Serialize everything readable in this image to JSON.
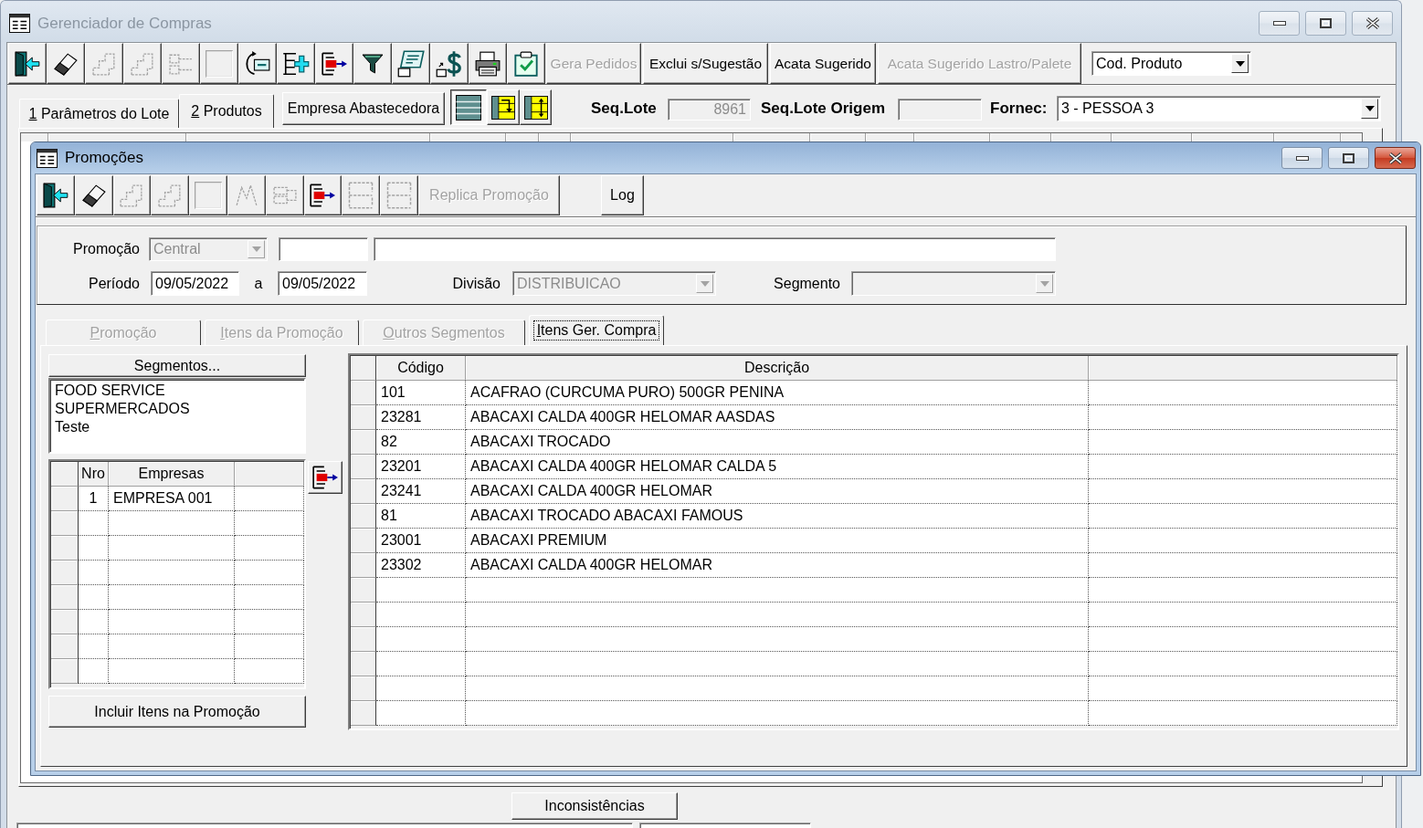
{
  "main_window": {
    "title": "Gerenciador de Compras",
    "active": false,
    "toolbar": [
      {
        "kind": "icon",
        "disabled": false
      },
      {
        "kind": "icon",
        "disabled": false
      },
      {
        "kind": "icon",
        "disabled": true
      },
      {
        "kind": "icon",
        "disabled": true
      },
      {
        "kind": "icon",
        "disabled": true
      },
      {
        "kind": "icon",
        "disabled": true
      },
      {
        "kind": "icon",
        "disabled": false
      },
      {
        "kind": "icon",
        "disabled": false
      },
      {
        "kind": "icon",
        "disabled": false
      },
      {
        "kind": "icon",
        "disabled": false
      },
      {
        "kind": "icon",
        "disabled": false
      },
      {
        "kind": "icon",
        "disabled": false
      },
      {
        "kind": "icon",
        "disabled": false
      },
      {
        "kind": "icon",
        "disabled": false
      },
      {
        "kind": "text",
        "label": "Gera Pedidos",
        "disabled": true
      },
      {
        "kind": "text",
        "label": "Exclui s/Sugestão",
        "disabled": false
      },
      {
        "kind": "text",
        "label": "Acata Sugerido",
        "disabled": false
      },
      {
        "kind": "text",
        "label": "Acata Sugerido Lastro/Palete",
        "disabled": true
      }
    ],
    "sort_field": {
      "value": "Cod. Produto"
    },
    "tabs": [
      {
        "label": "1 Parâmetros do Lote",
        "selected": false
      },
      {
        "label": "2 Produtos",
        "selected": true
      }
    ],
    "supplier_button": {
      "label": "Empresa Abastecedora"
    },
    "view_buttons": [
      {
        "pressed": true
      },
      {
        "pressed": false
      },
      {
        "pressed": false
      }
    ],
    "seq_lote": {
      "label": "Seq.Lote",
      "value": "8961",
      "disabled": true
    },
    "seq_lote_origem": {
      "label": "Seq.Lote Origem",
      "disabled": true
    },
    "fornec": {
      "label": "Fornec:",
      "value": "3 - PESSOA 3"
    },
    "inconsistencies_button": {
      "label": "Inconsistências"
    }
  },
  "promo_window": {
    "title": "Promoções",
    "active": true,
    "toolbar": [
      {
        "kind": "icon",
        "disabled": false
      },
      {
        "kind": "icon",
        "disabled": false
      },
      {
        "kind": "icon",
        "disabled": true
      },
      {
        "kind": "icon",
        "disabled": true
      },
      {
        "kind": "icon",
        "disabled": true
      },
      {
        "kind": "icon",
        "disabled": true
      },
      {
        "kind": "icon",
        "disabled": true
      },
      {
        "kind": "icon",
        "disabled": false
      },
      {
        "kind": "icon",
        "disabled": true
      },
      {
        "kind": "icon",
        "disabled": true
      },
      {
        "kind": "text",
        "label": "Replica Promoção",
        "disabled": true
      },
      {
        "kind": "text",
        "label": "Log",
        "disabled": false
      }
    ],
    "promocao": {
      "label": "Promoção",
      "value": "Central",
      "disabled": true
    },
    "periodo": {
      "label": "Período",
      "from": "09/05/2022",
      "separator": "a",
      "to": "09/05/2022"
    },
    "divisao": {
      "label": "Divisão",
      "value": "DISTRIBUICAO",
      "disabled": true
    },
    "segmento": {
      "label": "Segmento",
      "disabled": true
    },
    "tabs": [
      {
        "label": "Promoção",
        "selected": false,
        "disabled": true
      },
      {
        "label": "Itens da Promoção",
        "selected": false,
        "disabled": true
      },
      {
        "label": "Outros Segmentos",
        "selected": false,
        "disabled": true
      },
      {
        "label": "Itens Ger. Compra",
        "selected": true,
        "disabled": false
      }
    ],
    "segments_button": {
      "label": "Segmentos..."
    },
    "segments": [
      "FOOD SERVICE",
      "SUPERMERCADOS",
      "Teste"
    ],
    "companies_table": {
      "columns": [
        "Nro",
        "Empresas"
      ],
      "rows": [
        [
          "1",
          "EMPRESA 001"
        ]
      ]
    },
    "include_button": {
      "label": "Incluir Itens na Promoção"
    },
    "items_table": {
      "columns": [
        "Código",
        "Descrição"
      ],
      "rows": [
        [
          "101",
          "ACAFRAO (CURCUMA PURO) 500GR PENINA"
        ],
        [
          "23281",
          "ABACAXI CALDA 400GR HELOMAR AASDAS"
        ],
        [
          "82",
          "ABACAXI TROCADO"
        ],
        [
          "23201",
          "ABACAXI CALDA 400GR HELOMAR CALDA 5"
        ],
        [
          "23241",
          "ABACAXI CALDA 400GR HELOMAR"
        ],
        [
          "81",
          "ABACAXI TROCADO ABACAXI FAMOUS"
        ],
        [
          "23001",
          "ABACAXI PREMIUM"
        ],
        [
          "23302",
          "ABACAXI CALDA 400GR HELOMAR"
        ]
      ]
    }
  }
}
